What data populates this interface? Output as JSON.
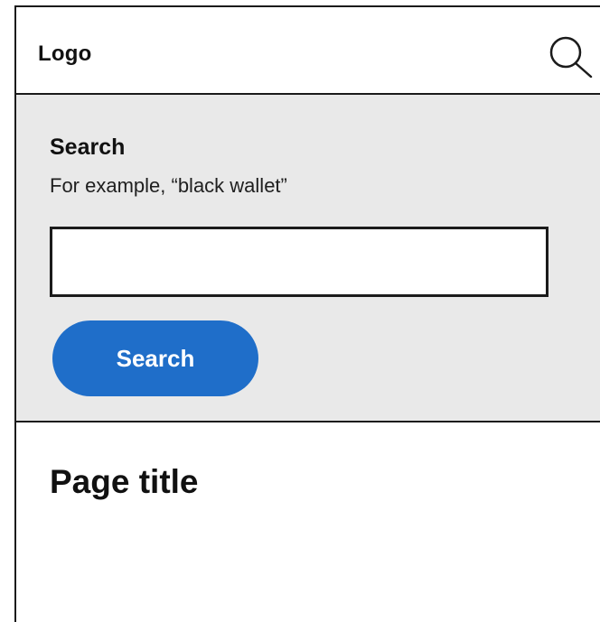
{
  "header": {
    "logo_text": "Logo",
    "search_icon": "magnifier-icon"
  },
  "search_panel": {
    "label": "Search",
    "hint": "For example, “black wallet”",
    "input_value": "",
    "button_label": "Search"
  },
  "main": {
    "page_title": "Page title"
  },
  "colors": {
    "panel_background": "#e9e9e9",
    "button_background": "#1f6ec9",
    "border": "#1b1b1b"
  }
}
